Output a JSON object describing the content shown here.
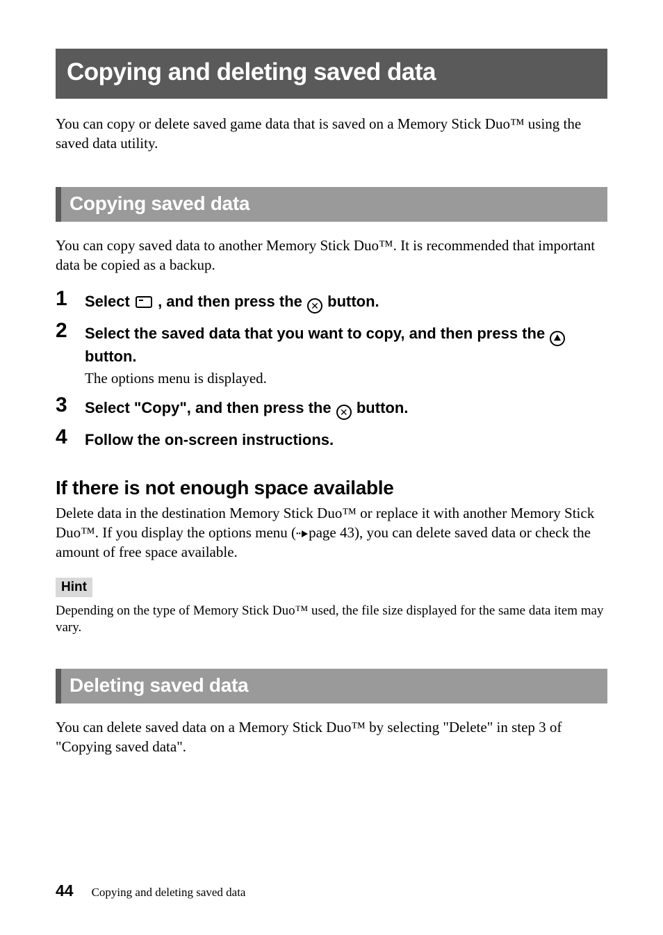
{
  "title": "Copying and deleting saved data",
  "intro": "You can copy or delete saved game data that is saved on a Memory Stick Duo™ using the saved data utility.",
  "section1": {
    "heading": "Copying saved data",
    "intro": "You can copy saved data to another Memory Stick Duo™. It is recommended that important data be copied as a backup.",
    "steps": {
      "s1a": "Select ",
      "s1b": ", and then press the ",
      "s1c": " button.",
      "s2a": "Select the saved data that you want to copy, and then press the ",
      "s2b": " button.",
      "s2desc": "The options menu is displayed.",
      "s3a": "Select \"Copy\", and then press the ",
      "s3b": " button.",
      "s4": "Follow the on-screen instructions."
    }
  },
  "sub": {
    "heading": "If there is not enough space available",
    "body_a": "Delete data in the destination Memory Stick Duo™ or replace it with another Memory Stick Duo™. If you display the options menu (",
    "body_pageref": "page 43",
    "body_b": "), you can delete saved data or check the amount of free space available."
  },
  "hint": {
    "label": "Hint",
    "body": "Depending on the type of Memory Stick Duo™ used, the file size displayed for the same data item may vary."
  },
  "section2": {
    "heading": "Deleting saved data",
    "body": "You can delete saved data on a Memory Stick Duo™ by selecting \"Delete\" in step 3 of \"Copying saved data\"."
  },
  "footer": {
    "page": "44",
    "title": "Copying and deleting saved data"
  },
  "icons": {
    "x": "✕"
  }
}
